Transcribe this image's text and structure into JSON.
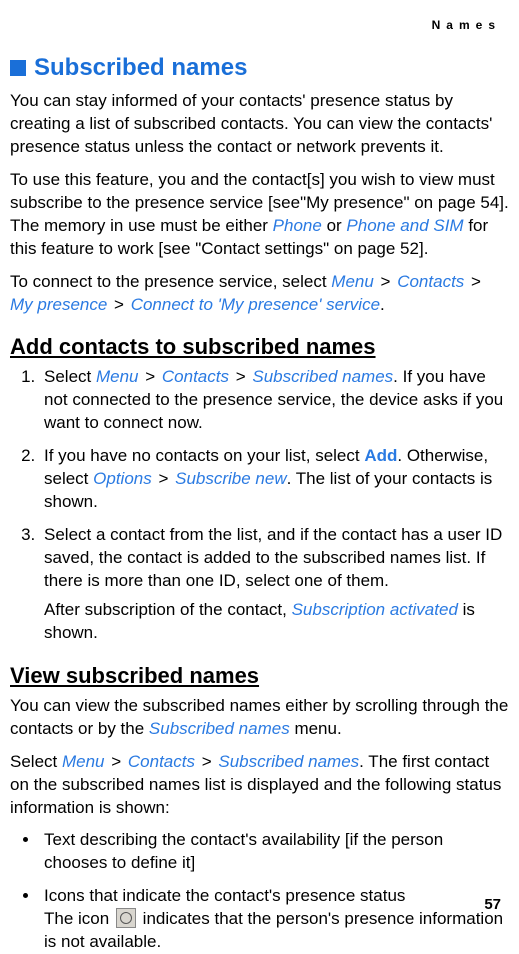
{
  "header": {
    "label": "Names"
  },
  "section": {
    "title": "Subscribed names"
  },
  "intro": {
    "p1": "You can stay informed of your contacts' presence status by creating a list of subscribed contacts. You can view the contacts' presence status unless the contact or network prevents it.",
    "p2_a": "To use this feature, you and the contact[s] you wish to view must subscribe to the presence service [see\"My presence\" on page 54]. The memory in use must be either ",
    "p2_phone": "Phone",
    "p2_b": " or ",
    "p2_phone_sim": "Phone and SIM",
    "p2_c": " for this feature to work [see \"Contact settings\" on page 52].",
    "p3_a": "To connect to the presence service, select ",
    "p3_menu": "Menu",
    "p3_gt1": " > ",
    "p3_contacts": "Contacts",
    "p3_gt2": " > ",
    "p3_mypresence": "My presence",
    "p3_gt3": " > ",
    "p3_connect": "Connect to 'My presence' service",
    "p3_end": "."
  },
  "sub1": {
    "title": "Add contacts to subscribed names",
    "step1_a": "Select ",
    "step1_menu": "Menu",
    "step1_gt1": " > ",
    "step1_contacts": "Contacts",
    "step1_gt2": " > ",
    "step1_subnames": "Subscribed names",
    "step1_b": ". If you have not connected to the presence service, the device asks if you want to connect now.",
    "step2_a": "If you have no contacts on your list, select ",
    "step2_add": "Add",
    "step2_b": ". Otherwise, select ",
    "step2_options": "Options",
    "step2_gt": " > ",
    "step2_subnew": "Subscribe new",
    "step2_c": ". The list of your contacts is shown.",
    "step3_a": "Select a contact from the list, and if the contact has a user ID saved, the contact is added to the subscribed names list. If there is more than one ID, select one of them.",
    "step3_after_a": "After subscription of the contact, ",
    "step3_after_b": "Subscription activated",
    "step3_after_c": " is shown."
  },
  "sub2": {
    "title": "View subscribed names",
    "p1_a": "You can view the subscribed names either by scrolling through the contacts or by the ",
    "p1_subnames": "Subscribed names",
    "p1_b": " menu.",
    "p2_a": "Select ",
    "p2_menu": "Menu",
    "p2_gt1": " > ",
    "p2_contacts": "Contacts",
    "p2_gt2": " > ",
    "p2_subnames": "Subscribed names",
    "p2_b": ". The first contact on the subscribed names list is displayed and the following status information is shown:",
    "b1": "Text describing the contact's availability [if the person chooses to define it]",
    "b2_a": "Icons that indicate the contact's presence status",
    "b2_b_a": "The icon ",
    "b2_b_b": " indicates that the person's presence information is not available."
  },
  "page": {
    "num": "57"
  }
}
